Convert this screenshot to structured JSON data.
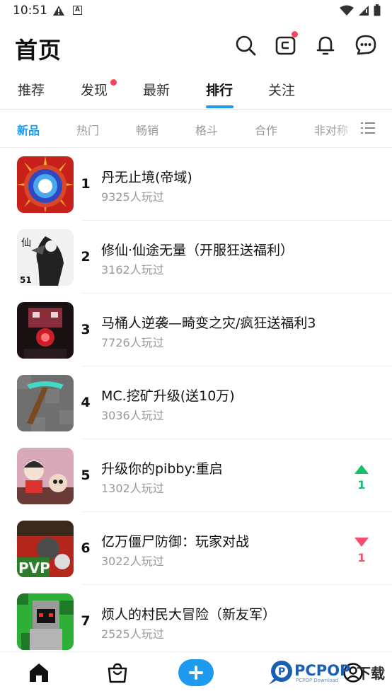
{
  "status_bar": {
    "time": "10:51",
    "left_icons": [
      "warning-icon",
      "a-icon"
    ],
    "right_icons": [
      "wifi-icon",
      "signal-icon",
      "battery-icon"
    ]
  },
  "header": {
    "title": "首页",
    "icons": [
      "search-icon",
      "wallet-icon",
      "bell-icon",
      "message-icon"
    ]
  },
  "tabs": [
    {
      "label": "推荐"
    },
    {
      "label": "发现"
    },
    {
      "label": "最新"
    },
    {
      "label": "排行"
    },
    {
      "label": "关注"
    }
  ],
  "active_tab": "排行",
  "subtabs": [
    {
      "label": "新品"
    },
    {
      "label": "热门"
    },
    {
      "label": "畅销"
    },
    {
      "label": "格斗"
    },
    {
      "label": "合作"
    },
    {
      "label": "非对称"
    }
  ],
  "active_subtab": "新品",
  "games": [
    {
      "rank": "1",
      "name": "丹无止境(帝域)",
      "players": "9325人玩过"
    },
    {
      "rank": "2",
      "name": "修仙·仙途无量（开服狂送福利）",
      "players": "3162人玩过"
    },
    {
      "rank": "3",
      "name": "马桶人逆袭—畸变之灾/疯狂送福利3",
      "players": "7726人玩过"
    },
    {
      "rank": "4",
      "name": "MC.挖矿升级(送10万)",
      "players": "3036人玩过"
    },
    {
      "rank": "5",
      "name": "升级你的pibby:重启",
      "players": "1302人玩过",
      "trend": "up",
      "change": "1"
    },
    {
      "rank": "6",
      "name": "亿万僵尸防御：玩家对战",
      "players": "3022人玩过",
      "trend": "down",
      "change": "1"
    },
    {
      "rank": "7",
      "name": "烦人的村民大冒险（新友军）",
      "players": "2525人玩过"
    }
  ],
  "colors": {
    "accent": "#1e9bef",
    "badge": "#f2455b",
    "trend_up": "#15c26b",
    "trend_down": "#f4506e"
  },
  "bottom_nav": {
    "icons": [
      "home-icon",
      "bag-icon",
      "plus-icon",
      "profile-icon"
    ]
  },
  "watermark": {
    "brand": "PCPOP",
    "sub": "PCPOP Download",
    "action": "下载"
  }
}
